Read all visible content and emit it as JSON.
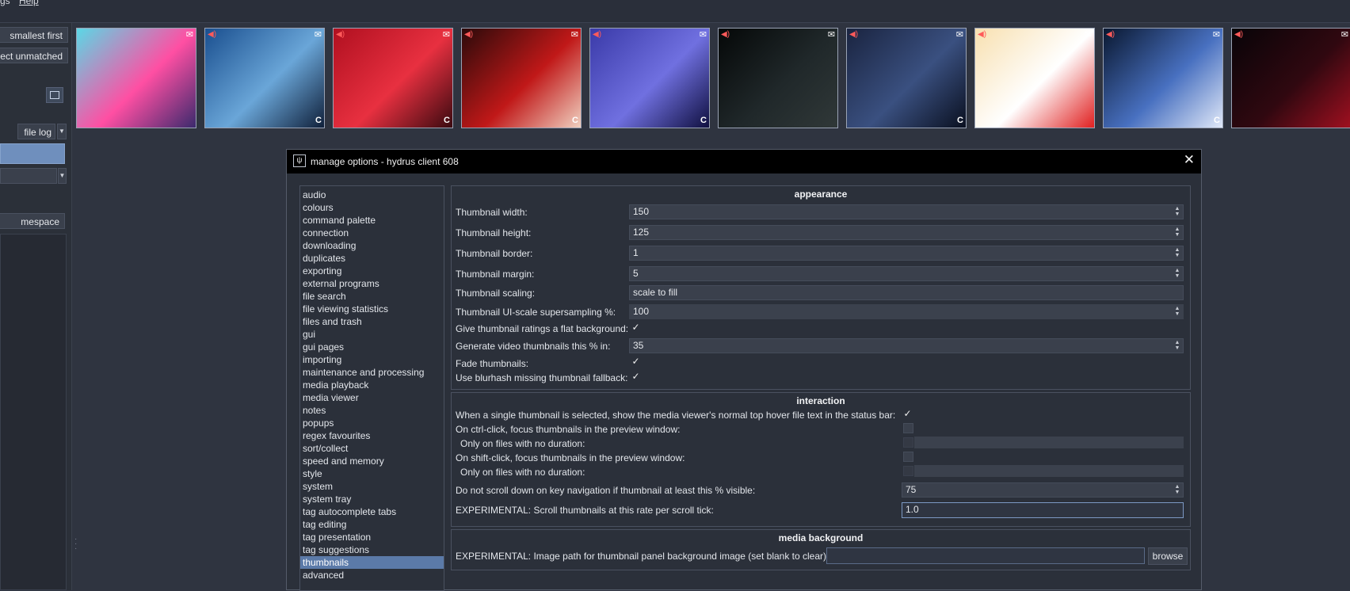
{
  "menubar": {
    "items": [
      "gs",
      "Help"
    ]
  },
  "left_panel": {
    "buttons": [
      "smallest first",
      "ect unmatched"
    ],
    "file_log": "file log",
    "namespace": "mespace (user)"
  },
  "thumbnails": [
    {
      "name": "thumb-1",
      "colors": [
        "#5ad8e6",
        "#ff4fa3",
        "#3b2a6d"
      ],
      "sound": false,
      "c": false
    },
    {
      "name": "thumb-2",
      "colors": [
        "#1a4f8f",
        "#6aa6d8",
        "#10203a"
      ],
      "sound": true,
      "c": true
    },
    {
      "name": "thumb-3",
      "colors": [
        "#b01020",
        "#e83040",
        "#3a0a10"
      ],
      "sound": true,
      "c": true
    },
    {
      "name": "thumb-4",
      "colors": [
        "#2a0a0a",
        "#c01818",
        "#f0d0c0"
      ],
      "sound": true,
      "c": true
    },
    {
      "name": "thumb-5",
      "colors": [
        "#3a3aa8",
        "#7070e0",
        "#101040"
      ],
      "sound": true,
      "c": true
    },
    {
      "name": "thumb-6",
      "colors": [
        "#050808",
        "#20282a",
        "#303838"
      ],
      "sound": true,
      "c": false
    },
    {
      "name": "thumb-7",
      "colors": [
        "#1a2440",
        "#3a5080",
        "#0a1020"
      ],
      "sound": true,
      "c": true
    },
    {
      "name": "thumb-8",
      "colors": [
        "#f8e0b0",
        "#ffffff",
        "#e02020"
      ],
      "sound": true,
      "c": false
    },
    {
      "name": "thumb-9",
      "colors": [
        "#0a1830",
        "#4870c0",
        "#e0e8f8"
      ],
      "sound": true,
      "c": true
    },
    {
      "name": "thumb-10",
      "colors": [
        "#080408",
        "#300810",
        "#a01020"
      ],
      "sound": true,
      "c": false
    }
  ],
  "dialog": {
    "title": "manage options - hydrus client 608",
    "app_icon": "ψ",
    "close": "✕",
    "sidebar": [
      "audio",
      "colours",
      "command palette",
      "connection",
      "downloading",
      "duplicates",
      "exporting",
      "external programs",
      "file search",
      "file viewing statistics",
      "files and trash",
      "gui",
      "gui pages",
      "importing",
      "maintenance and processing",
      "media playback",
      "media viewer",
      "notes",
      "popups",
      "regex favourites",
      "sort/collect",
      "speed and memory",
      "style",
      "system",
      "system tray",
      "tag autocomplete tabs",
      "tag editing",
      "tag presentation",
      "tag suggestions",
      "thumbnails",
      "advanced"
    ],
    "selected_index": 29,
    "appearance": {
      "header": "appearance",
      "width_label": "Thumbnail width:",
      "width_value": "150",
      "height_label": "Thumbnail height:",
      "height_value": "125",
      "border_label": "Thumbnail border:",
      "border_value": "1",
      "margin_label": "Thumbnail margin:",
      "margin_value": "5",
      "scaling_label": "Thumbnail scaling:",
      "scaling_value": "scale to fill",
      "supersampling_label": "Thumbnail UI-scale supersampling %:",
      "supersampling_value": "100",
      "ratings_label": "Give thumbnail ratings a flat background:",
      "video_label": "Generate video thumbnails this % in:",
      "video_value": "35",
      "fade_label": "Fade thumbnails:",
      "blurhash_label": "Use blurhash missing thumbnail fallback:"
    },
    "interaction": {
      "header": "interaction",
      "single_label": "When a single thumbnail is selected, show the media viewer's normal top hover file text in the status bar:",
      "ctrl_label": "On ctrl-click, focus thumbnails in the preview window:",
      "ctrl_nodur_label": "Only on files with no duration:",
      "shift_label": "On shift-click, focus thumbnails in the preview window:",
      "shift_nodur_label": "Only on files with no duration:",
      "scroll_label": "Do not scroll down on key navigation if thumbnail at least this % visible:",
      "scroll_value": "75",
      "rate_label": "EXPERIMENTAL: Scroll thumbnails at this rate per scroll tick:",
      "rate_value": "1.0"
    },
    "media_background": {
      "header": "media background",
      "path_label": "EXPERIMENTAL: Image path for thumbnail panel background image (set blank to clear):",
      "path_value": "",
      "browse": "browse"
    },
    "checkmark": "✓",
    "spin_up": "▲",
    "spin_down": "▼"
  }
}
